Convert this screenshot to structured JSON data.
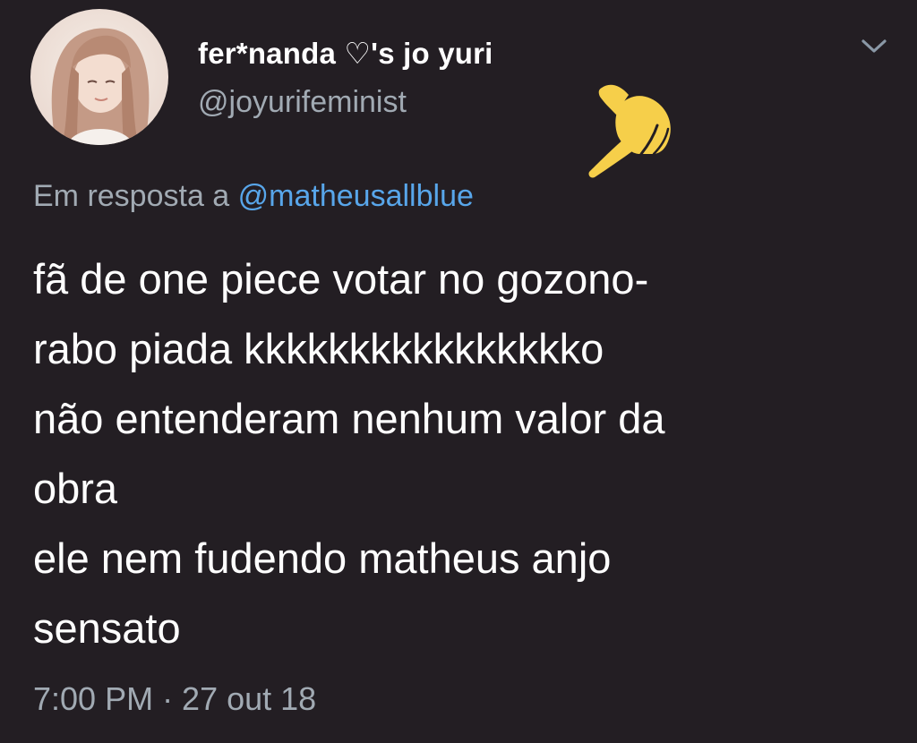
{
  "tweet": {
    "author": {
      "display_name": "fer*nanda ♡'s jo yuri",
      "handle": "@joyurifeminist"
    },
    "reply_to": {
      "prefix": "Em resposta a",
      "mention": "@matheusallblue"
    },
    "text_lines": [
      "fã de one piece votar no gozono-",
      "rabo piada kkkkkkkkkkkkkkkko",
      "não entenderam nenhum valor da",
      "obra",
      "ele nem fudendo matheus anjo",
      "sensato"
    ],
    "timestamp": "7:00 PM · 27 out 18"
  },
  "icons": {
    "menu": "chevron-down-icon",
    "emoji": "pointing-hand-emoji"
  },
  "colors": {
    "background": "#231e23",
    "text": "#ffffff",
    "secondary_text": "#a1aab3",
    "link": "#58a6ea",
    "emoji": "#f6cf4a"
  }
}
